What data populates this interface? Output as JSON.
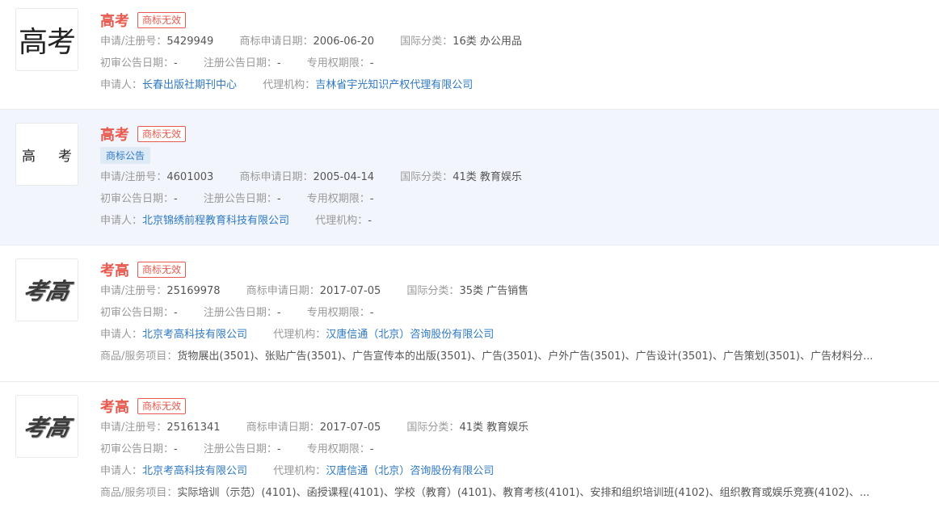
{
  "labels": {
    "reg_no": "申请/注册号：",
    "apply_date": "商标申请日期：",
    "intl_class": "国际分类：",
    "prelim_date": "初审公告日期：",
    "reg_date": "注册公告日期：",
    "exclusive_period": "专用权期限：",
    "applicant": "申请人：",
    "agency": "代理机构：",
    "goods": "商品/服务项目："
  },
  "items": [
    {
      "title": "高考",
      "status": "商标无效",
      "logo_text": "高考",
      "reg_no": "5429949",
      "apply_date": "2006-06-20",
      "intl_class": "16类 办公用品",
      "prelim_date": "-",
      "reg_date": "-",
      "exclusive_period": "-",
      "applicant": "长春出版社期刊中心",
      "agency": "吉林省宇光知识产权代理有限公司"
    },
    {
      "title": "高考",
      "status": "商标无效",
      "tag": "商标公告",
      "logo_text_left": "高",
      "logo_text_right": "考",
      "reg_no": "4601003",
      "apply_date": "2005-04-14",
      "intl_class": "41类 教育娱乐",
      "prelim_date": "-",
      "reg_date": "-",
      "exclusive_period": "-",
      "applicant": "北京锦绣前程教育科技有限公司",
      "agency": "-"
    },
    {
      "title": "考高",
      "status": "商标无效",
      "logo_text": "考高",
      "reg_no": "25169978",
      "apply_date": "2017-07-05",
      "intl_class": "35类 广告销售",
      "prelim_date": "-",
      "reg_date": "-",
      "exclusive_period": "-",
      "applicant": "北京考高科技有限公司",
      "agency": "汉唐信通（北京）咨询股份有限公司",
      "goods": "货物展出(3501)、张贴广告(3501)、广告宣传本的出版(3501)、广告(3501)、户外广告(3501)、广告设计(3501)、广告策划(3501)、广告材料分..."
    },
    {
      "title": "考高",
      "status": "商标无效",
      "logo_text": "考高",
      "reg_no": "25161341",
      "apply_date": "2017-07-05",
      "intl_class": "41类 教育娱乐",
      "prelim_date": "-",
      "reg_date": "-",
      "exclusive_period": "-",
      "applicant": "北京考高科技有限公司",
      "agency": "汉唐信通（北京）咨询股份有限公司",
      "goods": "实际培训（示范）(4101)、函授课程(4101)、学校（教育）(4101)、教育考核(4101)、安排和组织培训班(4102)、组织教育或娱乐竞赛(4102)、..."
    }
  ],
  "colors": {
    "title": "#e85a4f",
    "link": "#2f7ac2",
    "highlight_bg": "#f2f6fc"
  }
}
